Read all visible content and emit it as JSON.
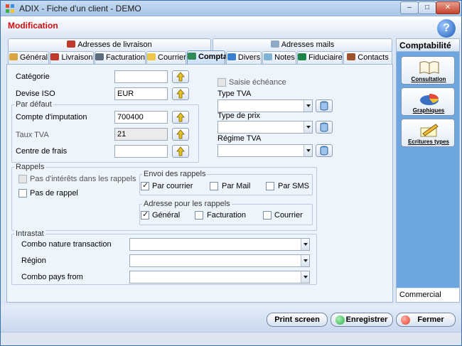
{
  "window": {
    "title": "ADIX - Fiche d'un client - DEMO",
    "min": "–",
    "max": "□",
    "close": "✕"
  },
  "header": {
    "mode": "Modification",
    "help": "?"
  },
  "tabs_top": [
    {
      "label": "Adresses  de livraison"
    },
    {
      "label": "Adresses mails"
    }
  ],
  "tabs": [
    {
      "label": "Général",
      "icon": "general-icon"
    },
    {
      "label": "Livraison",
      "icon": "truck-icon"
    },
    {
      "label": "Facturation",
      "icon": "invoice-icon"
    },
    {
      "label": "Courrier",
      "icon": "envelope-icon"
    },
    {
      "label": "Compta",
      "icon": "accounting-icon"
    },
    {
      "label": "Divers",
      "icon": "misc-icon"
    },
    {
      "label": "Notes",
      "icon": "notes-icon"
    },
    {
      "label": "Fiduciaire",
      "icon": "fiduciary-icon"
    },
    {
      "label": "Contacts",
      "icon": "contacts-icon"
    }
  ],
  "form": {
    "categorie_label": "Catégorie",
    "categorie_value": "",
    "devise_label": "Devise ISO",
    "devise_value": "EUR",
    "par_defaut_title": "Par défaut",
    "compte_label": "Compte d'imputation",
    "compte_value": "700400",
    "taux_label": "Taux TVA",
    "taux_value": "21",
    "centre_label": "Centre de frais",
    "centre_value": "",
    "saisie_label": "Saisie échéance",
    "type_tva_label": "Type TVA",
    "type_prix_label": "Type de prix",
    "regime_label": "Régime TVA"
  },
  "rappels": {
    "title": "Rappels",
    "interets_label": "Pas d'intérêts dans les rappels",
    "pas_rappel_label": "Pas de rappel",
    "envoi_title": "Envoi des rappels",
    "par_courrier": "Par courrier",
    "par_mail": "Par Mail",
    "par_sms": "Par SMS",
    "adresse_title": "Adresse pour les rappels",
    "general": "Général",
    "facturation": "Facturation",
    "courrier": "Courrier"
  },
  "intrastat": {
    "title": "Intrastat",
    "nature_label": "Combo nature transaction",
    "region_label": "Région",
    "pays_label": "Combo pays from"
  },
  "sidebar": {
    "title": "Comptabilité",
    "buttons": [
      {
        "label": "Consultation"
      },
      {
        "label": "Graphiques"
      },
      {
        "label": "Ecritures types"
      }
    ],
    "footer": "Commercial"
  },
  "footer": {
    "print": "Print screen",
    "save": "Enregistrer",
    "close": "Fermer"
  },
  "colors": {
    "accent": "#d01010",
    "save_dot": "#2fb14a",
    "close_dot": "#e23a2a"
  }
}
